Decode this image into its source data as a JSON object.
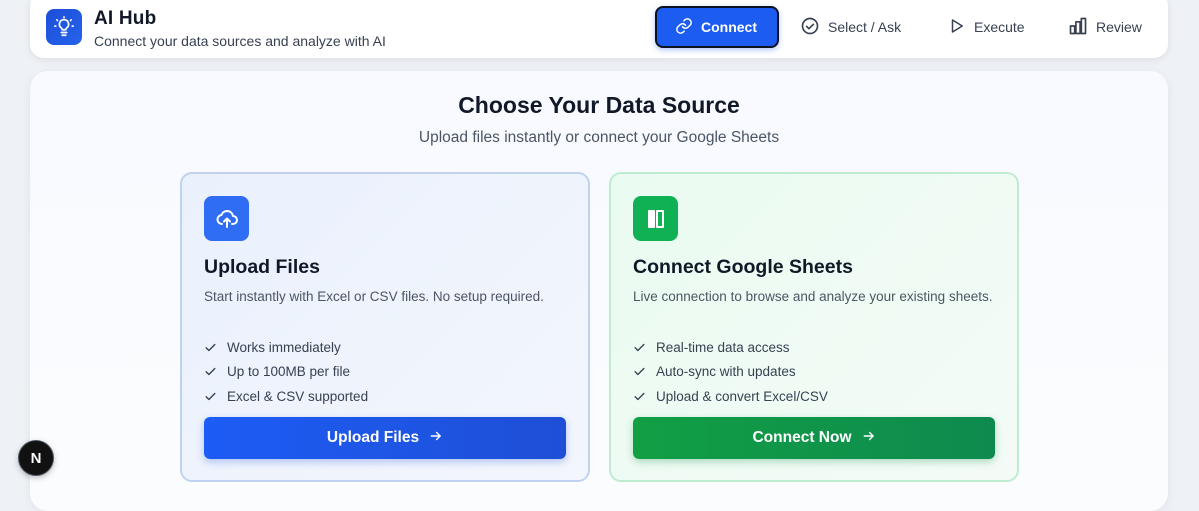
{
  "header": {
    "title": "AI Hub",
    "subtitle": "Connect your data sources and analyze with AI",
    "logo_icon": "lightbulb-icon",
    "accent_color": "#1d5cf0"
  },
  "steps": [
    {
      "label": "Connect",
      "icon": "link-icon",
      "active": true
    },
    {
      "label": "Select / Ask",
      "icon": "check-circle-icon",
      "active": false
    },
    {
      "label": "Execute",
      "icon": "play-icon",
      "active": false
    },
    {
      "label": "Review",
      "icon": "bar-chart-icon",
      "active": false
    }
  ],
  "main": {
    "heading": "Choose Your Data Source",
    "subheading": "Upload files instantly or connect your Google Sheets"
  },
  "cards": {
    "upload": {
      "icon": "cloud-upload-icon",
      "title": "Upload Files",
      "description": "Start instantly with Excel or CSV files. No setup required.",
      "features": [
        "Works immediately",
        "Up to 100MB per file",
        "Excel & CSV supported"
      ],
      "button_label": "Upload Files",
      "button_color": "#1d5cf5"
    },
    "sheets": {
      "icon": "sheets-icon",
      "title": "Connect Google Sheets",
      "description": "Live connection to browse and analyze your existing sheets.",
      "features": [
        "Real-time data access",
        "Auto-sync with updates",
        "Upload & convert Excel/CSV"
      ],
      "button_label": "Connect Now",
      "button_color": "#119f44"
    }
  },
  "dev_badge": {
    "label": "N"
  }
}
